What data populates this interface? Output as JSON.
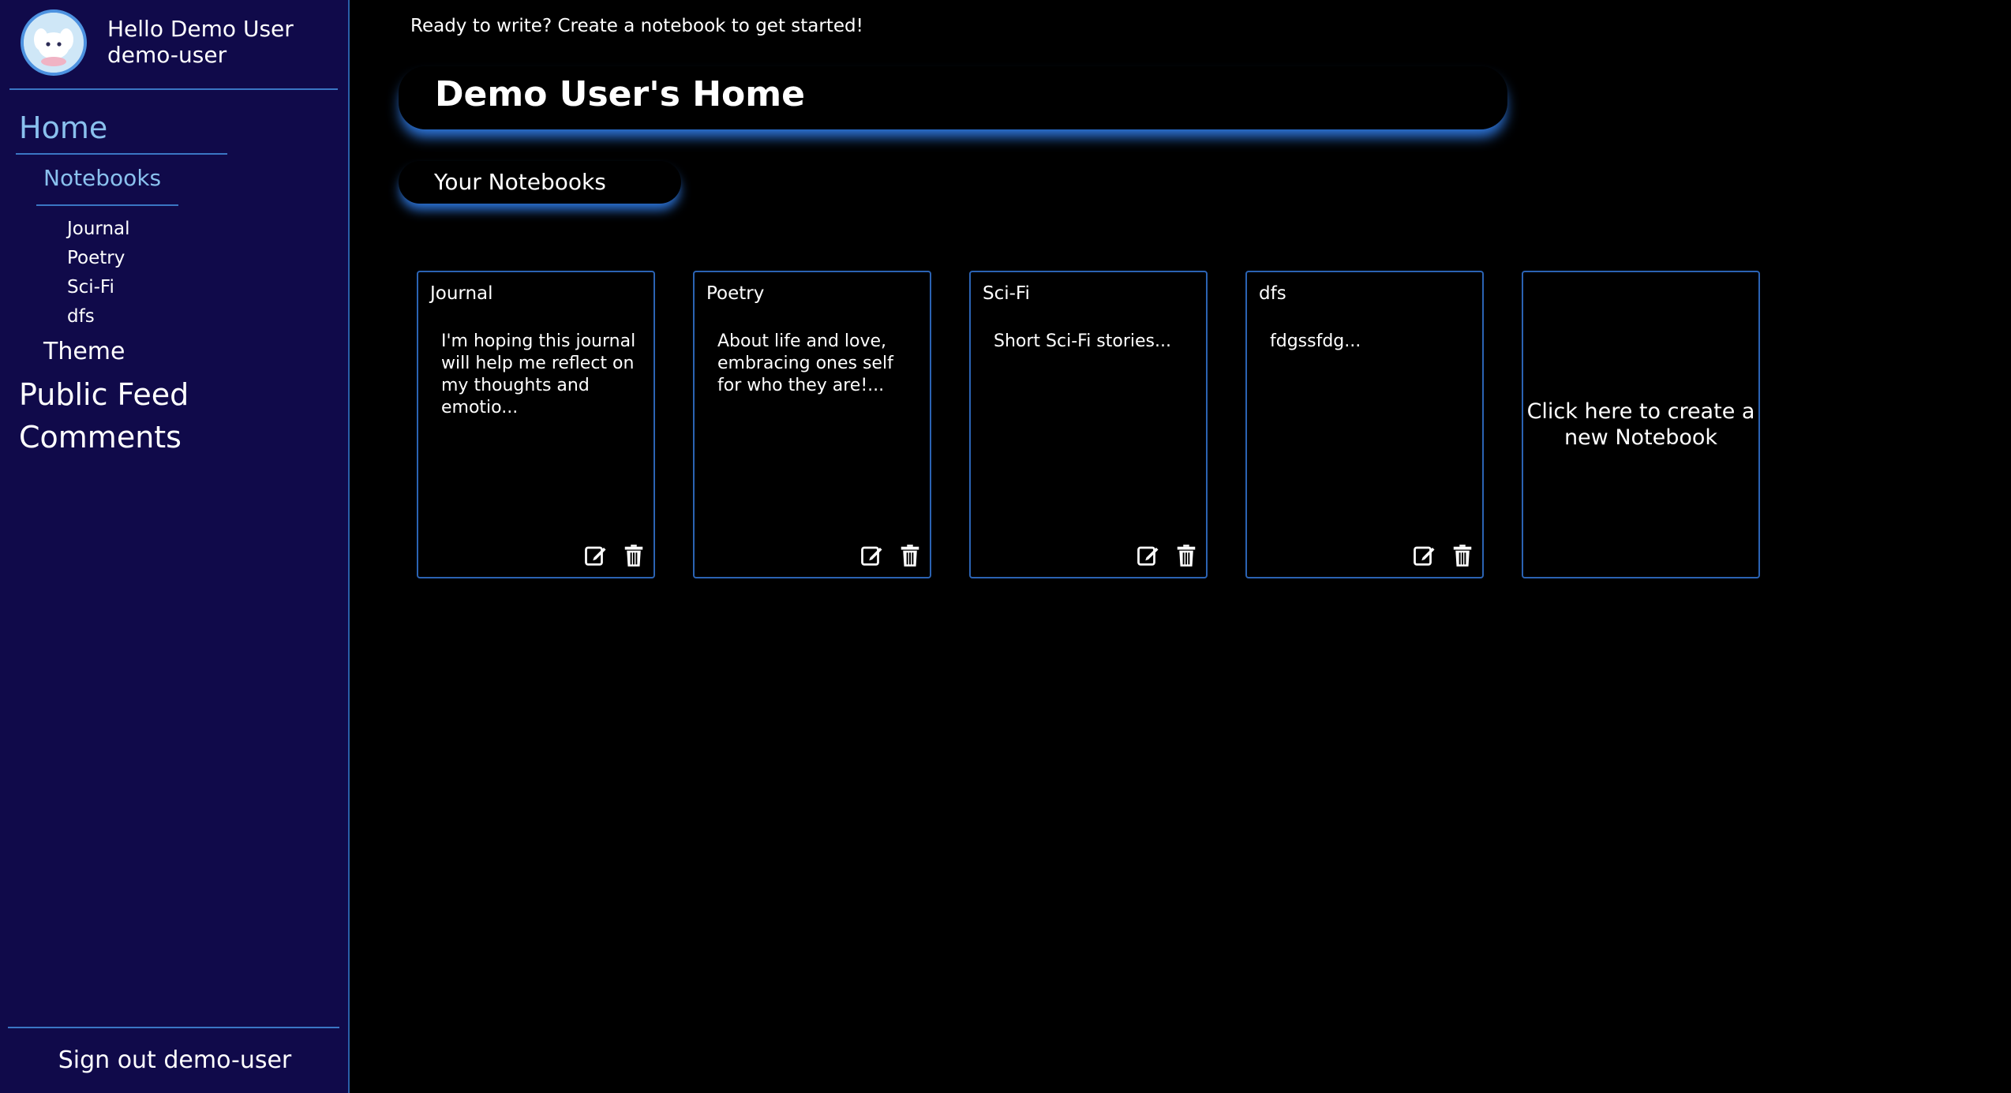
{
  "sidebar": {
    "greeting": "Hello Demo User",
    "username": "demo-user",
    "nav": {
      "home": "Home",
      "notebooks": "Notebooks",
      "notebook_items": [
        "Journal",
        "Poetry",
        "Sci-Fi",
        "dfs"
      ],
      "theme": "Theme",
      "public_feed": "Public Feed",
      "comments": "Comments"
    },
    "signout": "Sign out demo-user"
  },
  "main": {
    "intro": "Ready to write? Create a notebook to get started!",
    "title": "Demo User's Home",
    "section": "Your Notebooks",
    "notebooks": [
      {
        "title": "Journal",
        "desc": "I'm hoping this journal will help me reflect on my thoughts and emotio..."
      },
      {
        "title": "Poetry",
        "desc": "About life and love, embracing ones self for who they are!..."
      },
      {
        "title": "Sci-Fi",
        "desc": "Short Sci-Fi stories..."
      },
      {
        "title": "dfs",
        "desc": "fdgssfdg..."
      }
    ],
    "create_label": "Click here to create a new Notebook"
  },
  "icons": {
    "edit": "edit-icon",
    "delete": "trash-icon",
    "avatar": "avatar-image"
  },
  "colors": {
    "sidebar_bg": "#100a4a",
    "accent": "#2d74d8",
    "link": "#8ac1ee"
  }
}
